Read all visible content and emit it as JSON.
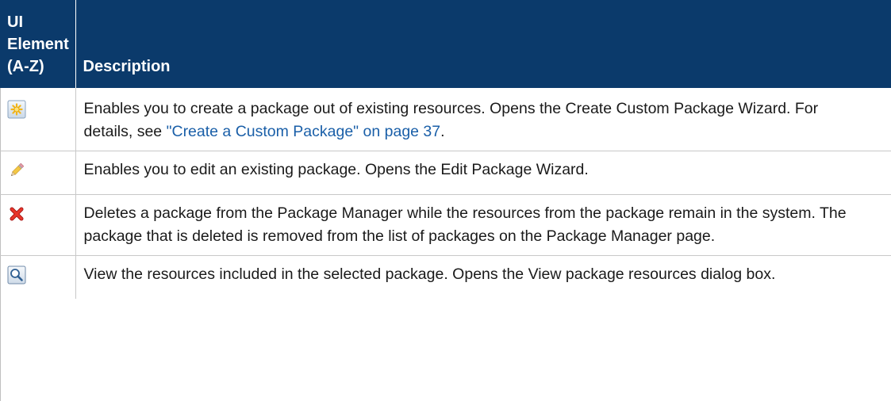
{
  "header": {
    "col1_label": "UI Element (A-Z)",
    "col2_label": "Description"
  },
  "rows": [
    {
      "icon": "new-package-icon",
      "description_prefix": "Enables you to create a package out of existing resources. Opens the Create Custom Package Wizard. For details, see ",
      "link_text": "\"Create a Custom Package\" on page 37",
      "description_suffix": "."
    },
    {
      "icon": "edit-pencil-icon",
      "description": "Enables you to edit an existing package. Opens the Edit Package Wizard."
    },
    {
      "icon": "delete-x-icon",
      "description": "Deletes a package from the Package Manager while the resources from the package remain in the system. The package that is deleted is removed from the list of packages on the Package Manager page."
    },
    {
      "icon": "view-magnifier-icon",
      "description": "View the resources included in the selected package. Opens the View package resources dialog box."
    }
  ],
  "colors": {
    "header_background": "#0b3a6b",
    "header_text": "#ffffff",
    "link": "#1a5fa8"
  }
}
